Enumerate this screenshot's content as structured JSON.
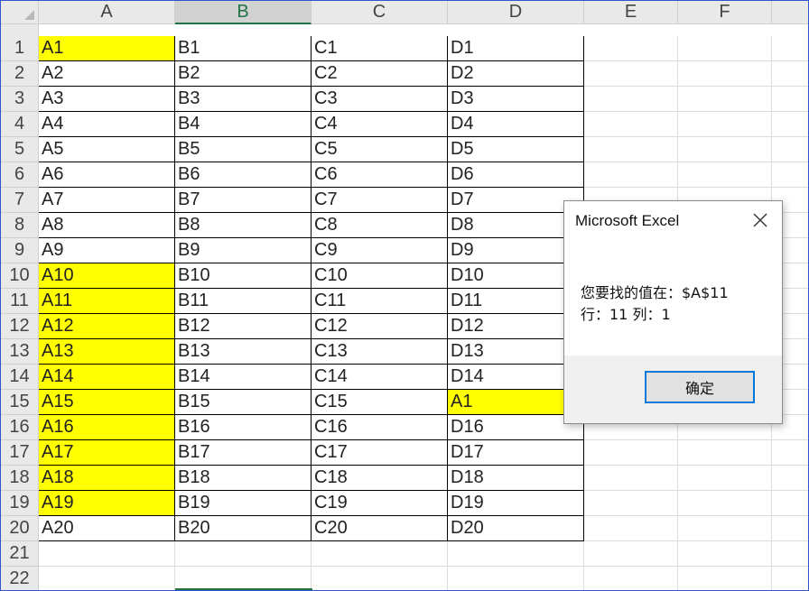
{
  "sheet": {
    "columns": [
      "A",
      "B",
      "C",
      "D",
      "E",
      "F"
    ],
    "selected_column": "B",
    "row_numbers": [
      "1",
      "2",
      "3",
      "4",
      "5",
      "6",
      "7",
      "8",
      "9",
      "10",
      "11",
      "12",
      "13",
      "14",
      "15",
      "16",
      "17",
      "18",
      "19",
      "20",
      "21",
      "22"
    ],
    "cells": [
      [
        "A1",
        "B1",
        "C1",
        "D1"
      ],
      [
        "A2",
        "B2",
        "C2",
        "D2"
      ],
      [
        "A3",
        "B3",
        "C3",
        "D3"
      ],
      [
        "A4",
        "B4",
        "C4",
        "D4"
      ],
      [
        "A5",
        "B5",
        "C5",
        "D5"
      ],
      [
        "A6",
        "B6",
        "C6",
        "D6"
      ],
      [
        "A7",
        "B7",
        "C7",
        "D7"
      ],
      [
        "A8",
        "B8",
        "C8",
        "D8"
      ],
      [
        "A9",
        "B9",
        "C9",
        "D9"
      ],
      [
        "A10",
        "B10",
        "C10",
        "D10"
      ],
      [
        "A11",
        "B11",
        "C11",
        "D11"
      ],
      [
        "A12",
        "B12",
        "C12",
        "D12"
      ],
      [
        "A13",
        "B13",
        "C13",
        "D13"
      ],
      [
        "A14",
        "B14",
        "C14",
        "D14"
      ],
      [
        "A15",
        "B15",
        "C15",
        "A1"
      ],
      [
        "A16",
        "B16",
        "C16",
        "D16"
      ],
      [
        "A17",
        "B17",
        "C17",
        "D17"
      ],
      [
        "A18",
        "B18",
        "C18",
        "D18"
      ],
      [
        "A19",
        "B19",
        "C19",
        "D19"
      ],
      [
        "A20",
        "B20",
        "C20",
        "D20"
      ]
    ],
    "highlighted_cells": [
      "A1",
      "A10",
      "A11",
      "A12",
      "A13",
      "A14",
      "A15",
      "A16",
      "A17",
      "A18",
      "A19",
      "D15"
    ],
    "highlight_color": "#ffff00"
  },
  "dialog": {
    "title": "Microsoft Excel",
    "message_line1": "您要找的值在：$A$11",
    "message_line2": "行：11 列：1",
    "ok_label": "确定",
    "close_icon": "close-icon"
  }
}
